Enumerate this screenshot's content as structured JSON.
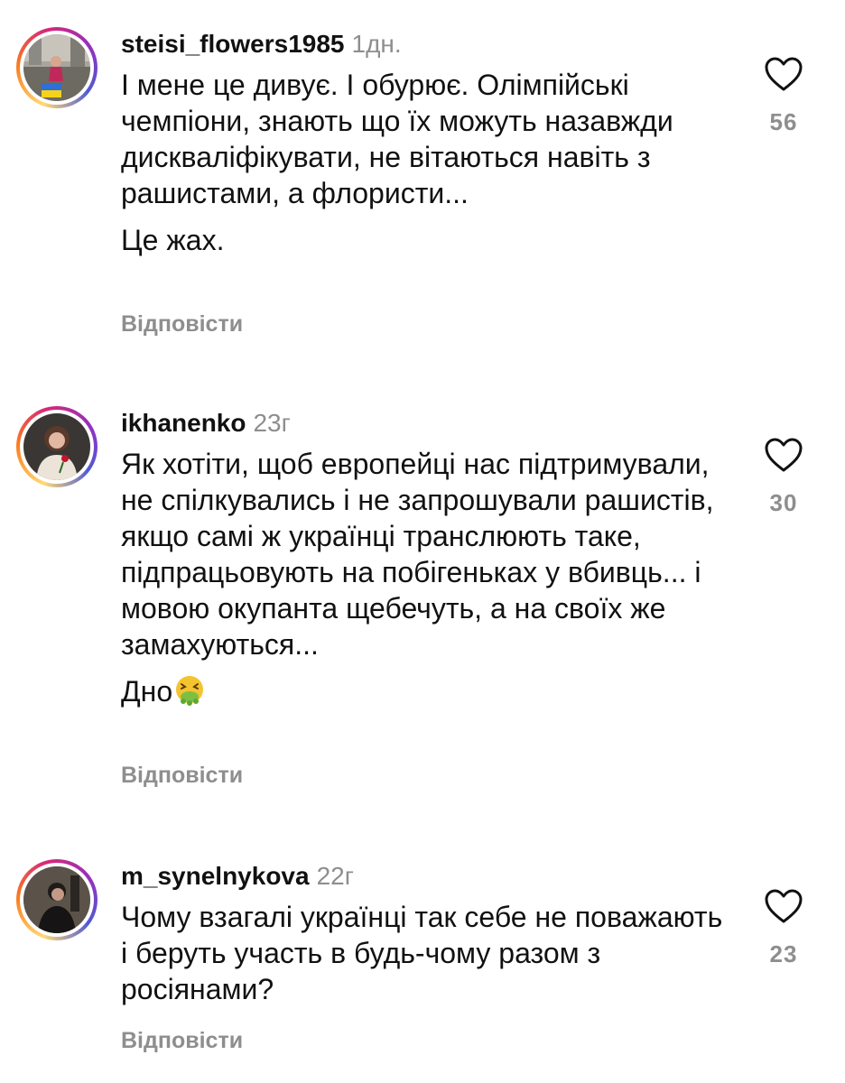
{
  "comments": [
    {
      "username": "steisi_flowers1985",
      "time": "1дн.",
      "paragraphs": [
        "І мене це дивує. І обурює. Олімпійські чемпіони, знають що їх можуть назавжди дискваліфікувати, не вітаються навіть з рашистами, а флористи...",
        "Це жах."
      ],
      "likes": "56",
      "reply_label": "Відповісти",
      "avatar": "woman-with-ukrainian-flag-avatar"
    },
    {
      "username": "ikhanenko",
      "time": "23г",
      "paragraphs": [
        "Як хотіти, щоб европейці нас підтримували, не спілкувались і не запрошували рашистів, якщо самі ж українці транслюють таке, підпрацьовують на побігеньках у вбивць... і мовою окупанта щебечуть, а на своїх же замахуються...",
        "Дно"
      ],
      "emoji": "nauseated-face-emoji",
      "likes": "30",
      "reply_label": "Відповісти",
      "avatar": "woman-with-rose-avatar"
    },
    {
      "username": "m_synelnykova",
      "time": "22г",
      "paragraphs": [
        "Чому взагалі українці так себе не поважають і беруть участь в будь-чому разом з росіянами?"
      ],
      "likes": "23",
      "reply_label": "Відповісти",
      "avatar": "person-in-dark-avatar"
    }
  ],
  "colors": {
    "text": "#111111",
    "secondary": "#8e8e8e",
    "story_ring": "#d62976"
  }
}
